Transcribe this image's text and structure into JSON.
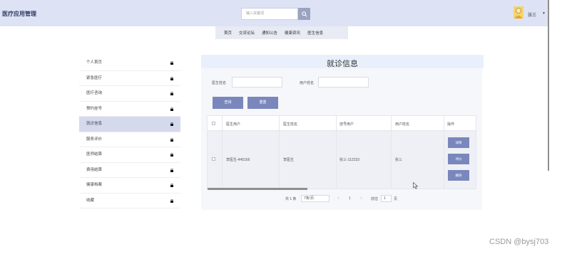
{
  "header": {
    "app_title": "医疗应用管理",
    "search_placeholder": "输入关键词",
    "username": "张三",
    "caret": "▼"
  },
  "nav": {
    "items": [
      "首页",
      "交流论坛",
      "通知公告",
      "健康资讯",
      "医生信息"
    ]
  },
  "sidebar": {
    "items": [
      {
        "label": "个人首页"
      },
      {
        "label": "紧急医疗"
      },
      {
        "label": "医疗咨询"
      },
      {
        "label": "预约挂号"
      },
      {
        "label": "就诊信息",
        "active": true
      },
      {
        "label": "服务评价"
      },
      {
        "label": "医师结算"
      },
      {
        "label": "费用结算"
      },
      {
        "label": "健康档案"
      },
      {
        "label": "收藏"
      }
    ]
  },
  "panel": {
    "title": "就诊信息",
    "filters": {
      "doctor_name_label": "医生姓名",
      "user_name_label": "用户姓名"
    },
    "buttons": {
      "query": "查询",
      "reset": "重置"
    }
  },
  "table": {
    "columns": [
      "医生用户",
      "医生姓名",
      "挂号用户",
      "用户姓名",
      "操作"
    ],
    "rows": [
      {
        "doctor_user": "李医生-445166",
        "doctor_name": "李医生",
        "register_user": "张三-112233",
        "user_name": "张三",
        "actions": [
          "详情",
          "评价",
          "删除"
        ]
      }
    ]
  },
  "pager": {
    "total": "共 1 条",
    "page_size": "7条/页",
    "prev": "<",
    "current": "1",
    "next": ">",
    "goto_label": "前往",
    "goto_value": "1",
    "page_suffix": "页"
  },
  "watermark": "CSDN @bysj703",
  "colors": {
    "topbar": "#dde3f4",
    "button": "#7a87bd",
    "active_item": "#d4d9ec"
  }
}
